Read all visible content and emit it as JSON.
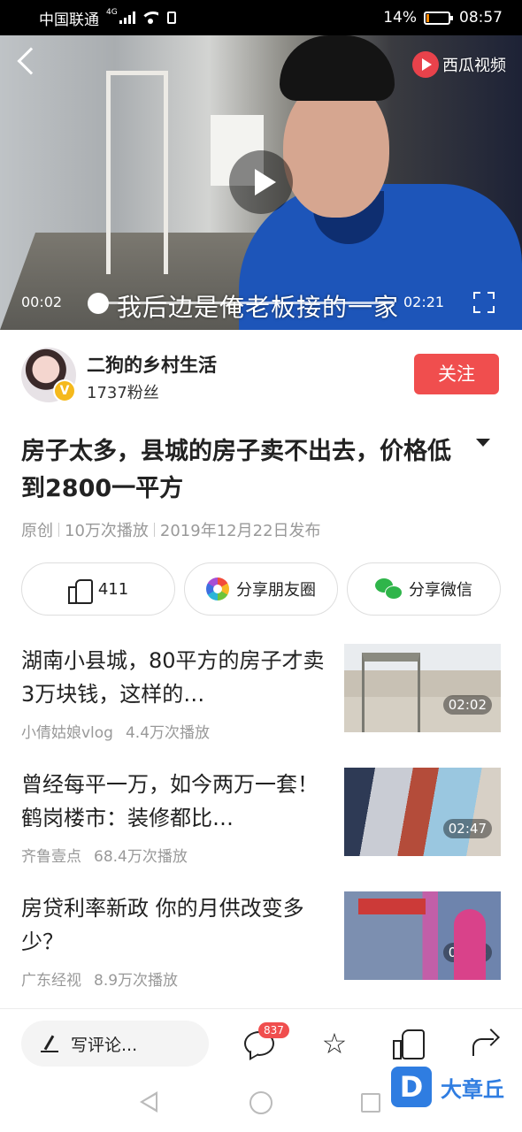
{
  "status_bar": {
    "carrier": "中国联通",
    "network": "4G",
    "battery_percent": "14%",
    "battery_level": 0.14,
    "time": "08:57"
  },
  "video": {
    "brand": "西瓜视频",
    "subtitle": "我后边是俺老板接的一家",
    "current_time": "00:02",
    "duration": "02:21",
    "progress": 0.014
  },
  "author": {
    "name": "二狗的乡村生活",
    "fans": "1737粉丝",
    "verified_badge": "V",
    "follow_label": "关注"
  },
  "article": {
    "title": "房子太多，县城的房子卖不出去，价格低到2800一平方",
    "meta": [
      "原创",
      "10万次播放",
      "2019年12月22日发布"
    ]
  },
  "actions": {
    "like_count": "411",
    "share_moments": "分享朋友圈",
    "share_wechat": "分享微信"
  },
  "related": [
    {
      "title": "湖南小县城，80平方的房子才卖3万块钱，这样的…",
      "source": "小倩姑娘vlog",
      "plays": "4.4万次播放",
      "duration": "02:02"
    },
    {
      "title": "曾经每平一万，如今两万一套！鹤岗楼市：装修都比…",
      "source": "齐鲁壹点",
      "plays": "68.4万次播放",
      "duration": "02:47"
    },
    {
      "title": "房贷利率新政 你的月供改变多少？",
      "source": "广东经视",
      "plays": "8.9万次播放",
      "duration": "02:46"
    }
  ],
  "bottom_bar": {
    "comment_placeholder": "写评论...",
    "comment_count": "837"
  },
  "watermark": {
    "logo_letter": "D",
    "text": "大章丘"
  },
  "colors": {
    "accent_red": "#f04e4e",
    "battery_orange": "#ff8a00",
    "watermark_blue": "#2f7de1"
  }
}
